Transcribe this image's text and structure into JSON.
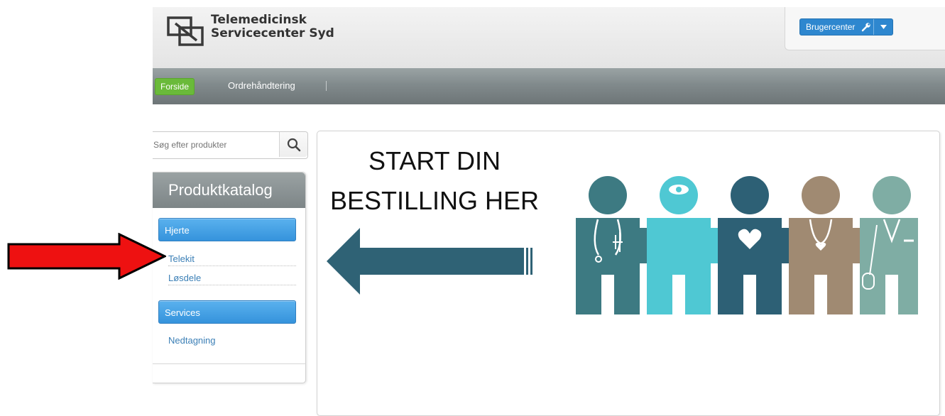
{
  "header": {
    "brand_line1": "Telemedicinsk",
    "brand_line2": "Servicecenter Syd",
    "user_menu_label": "Brugercenter"
  },
  "nav": {
    "tabs": [
      {
        "label": "Forside",
        "active": true
      },
      {
        "label": "Ordrehåndtering",
        "active": false
      }
    ]
  },
  "search": {
    "placeholder": "Søg efter produkter"
  },
  "catalog": {
    "title": "Produktkatalog",
    "groups": [
      {
        "label": "Hjerte",
        "items": [
          "Telekit",
          "Løsdele"
        ]
      },
      {
        "label": "Services",
        "items": [
          "Nedtagning"
        ]
      }
    ]
  },
  "banner": {
    "line1": "START DIN",
    "line2": "BESTILLING HER"
  },
  "colors": {
    "accent_blue": "#3593dc",
    "active_tab_green": "#6aba3a",
    "nav_gray": "#818a8c",
    "pointer_red": "#ee1111",
    "people": [
      "#3d7a82",
      "#4fc8d3",
      "#2d6075",
      "#a08a72",
      "#7fada4"
    ]
  }
}
